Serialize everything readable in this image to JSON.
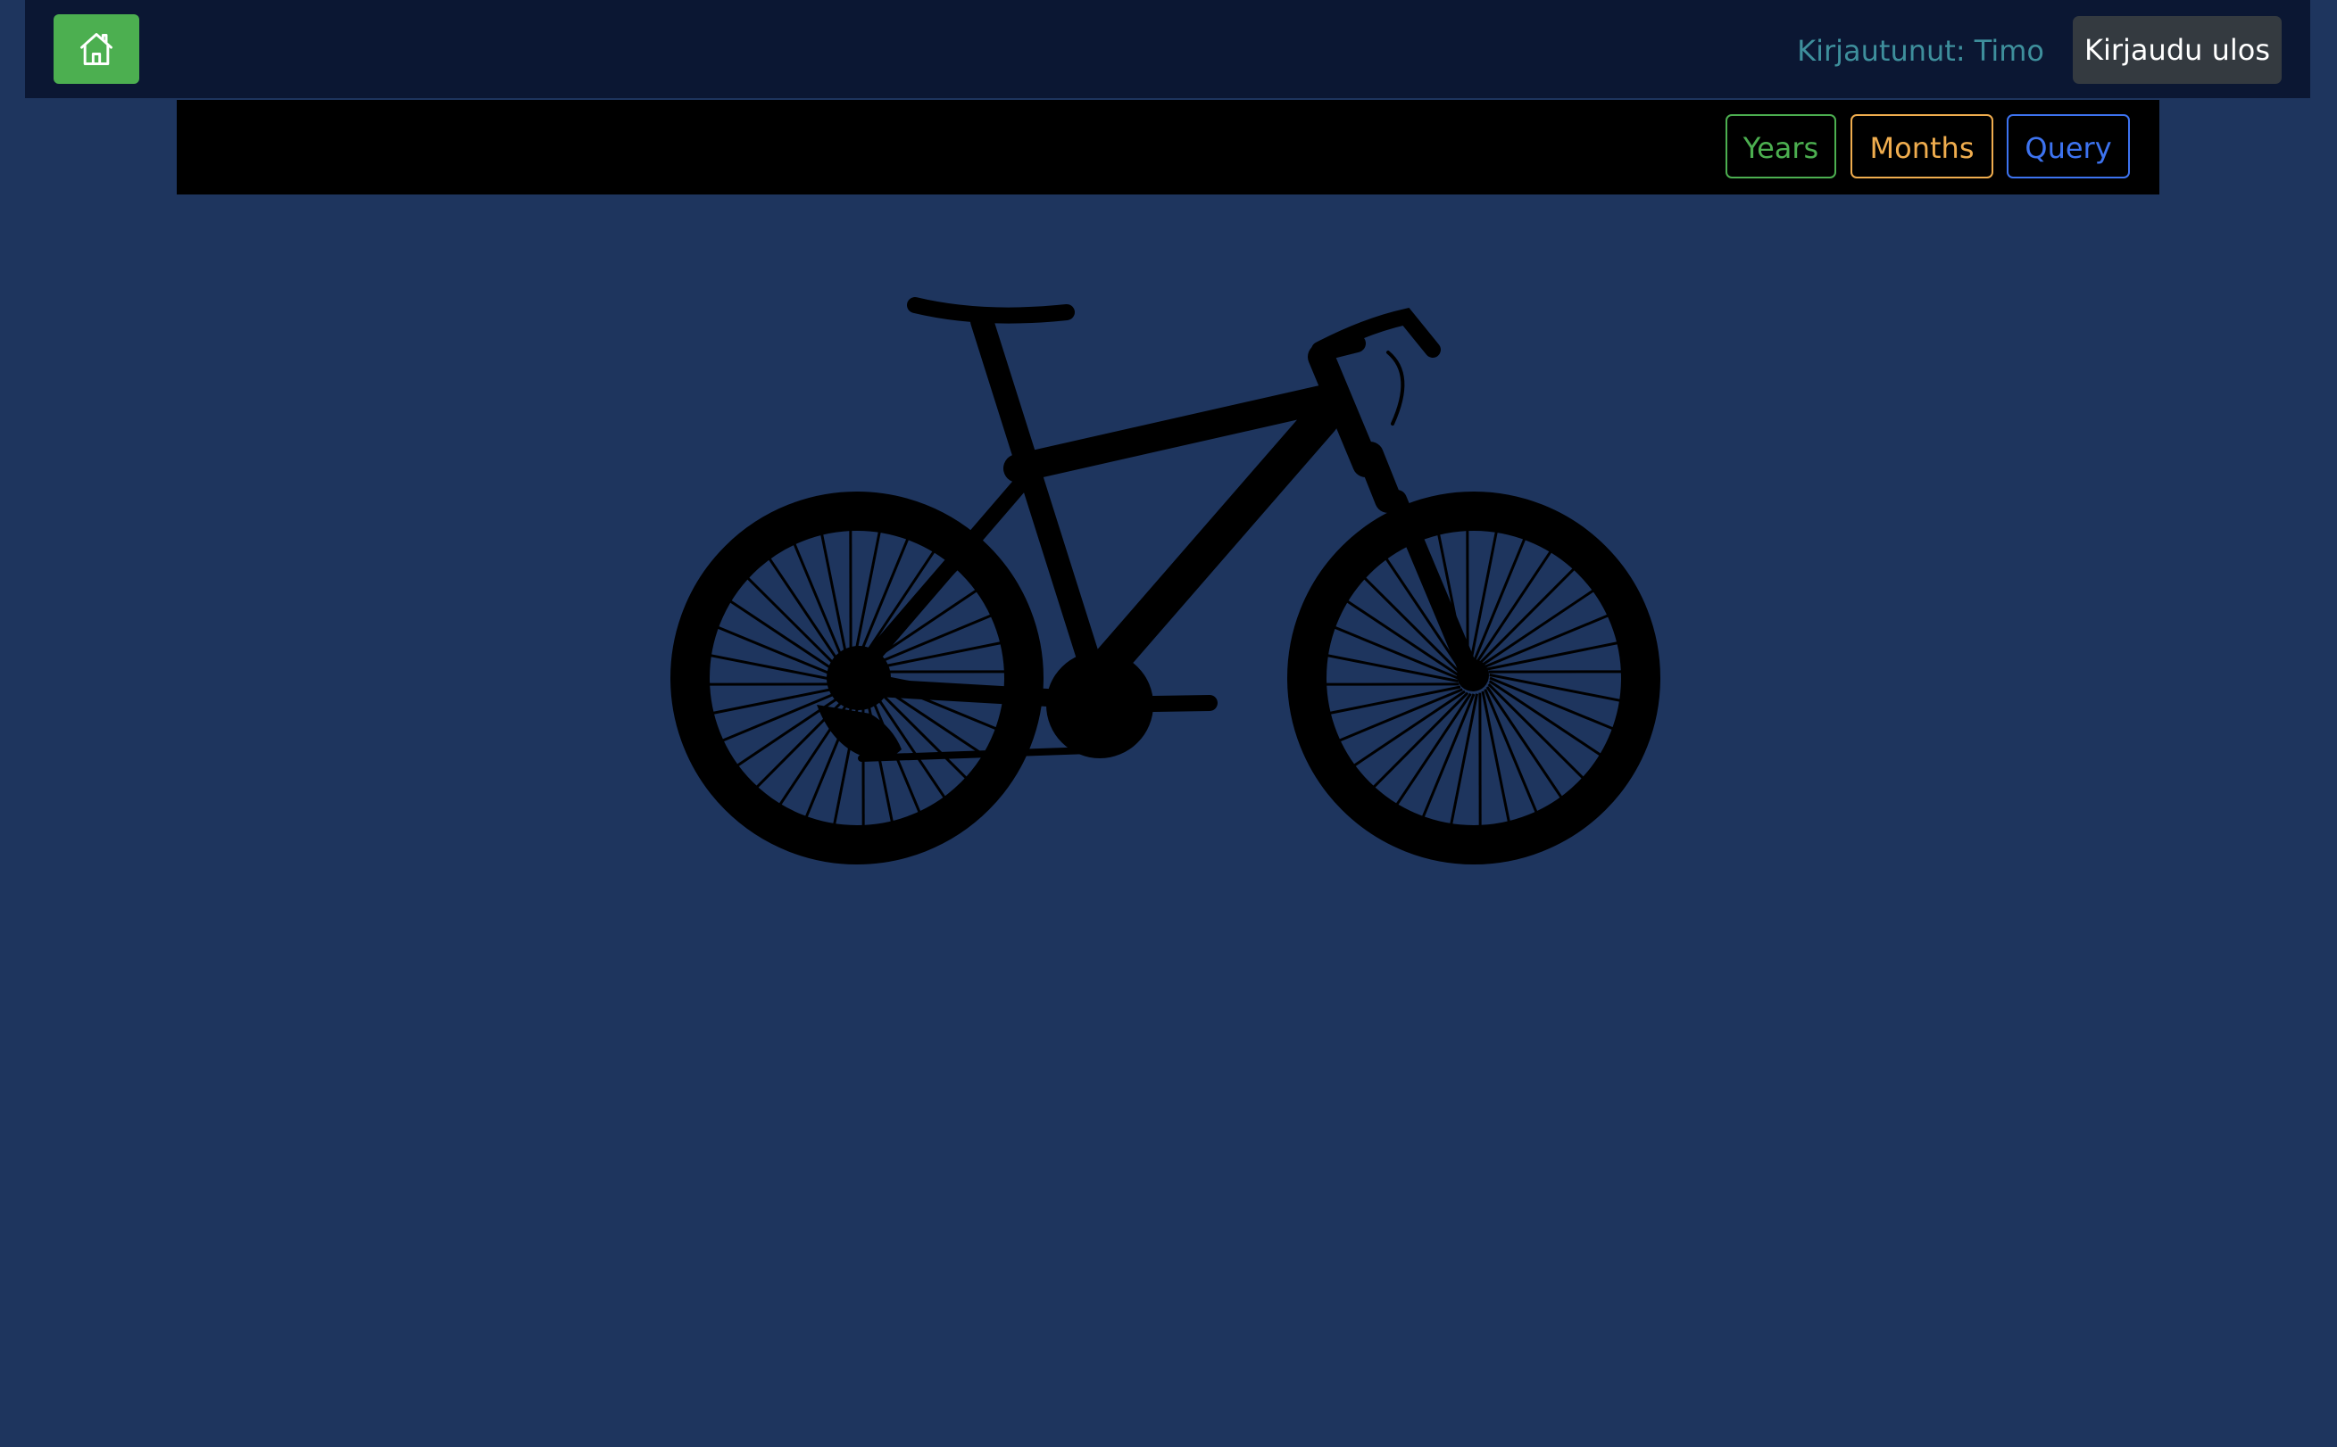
{
  "header": {
    "home_icon": "home-icon",
    "user_label": "Kirjautunut: Timo",
    "logout_label": "Kirjaudu ulos"
  },
  "nav": {
    "years_label": "Years",
    "months_label": "Months",
    "query_label": "Query"
  },
  "colors": {
    "page_bg": "#1e355e",
    "topbar_bg": "#0b1733",
    "home_button": "#4caf50",
    "years": "#4caf50",
    "months": "#f0ad4e",
    "query": "#3d73f0",
    "user_label": "#3e8f9c",
    "logout_bg": "#343a40"
  },
  "main": {
    "image_icon": "bicycle-silhouette-icon"
  }
}
